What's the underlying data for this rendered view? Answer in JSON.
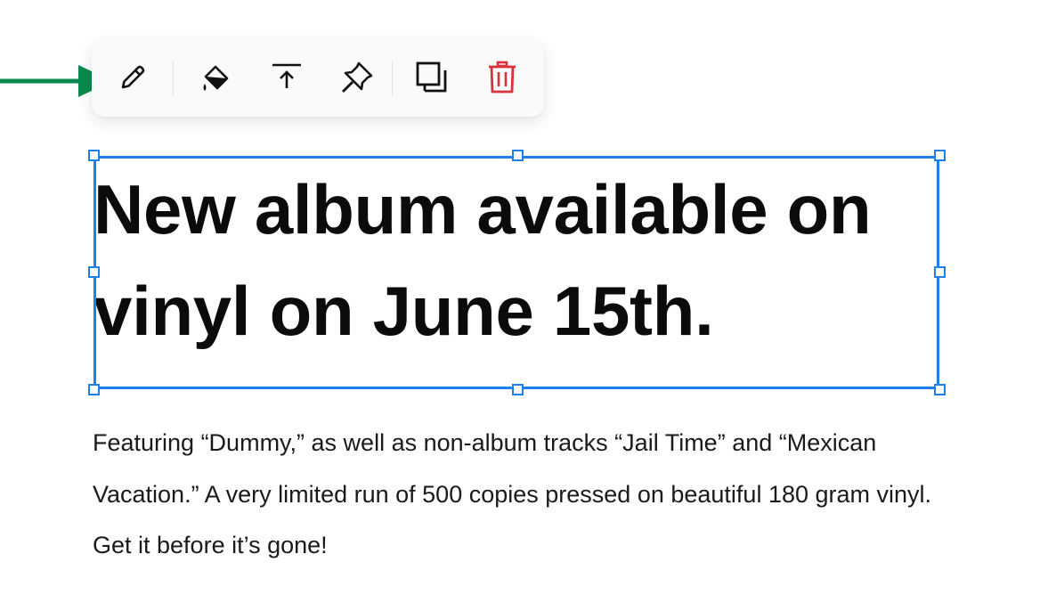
{
  "toolbar": {
    "buttons": [
      {
        "name": "edit",
        "icon": "pencil-icon"
      },
      {
        "name": "fill-color",
        "icon": "paint-bucket-icon"
      },
      {
        "name": "move-to-top",
        "icon": "arrow-up-to-line-icon"
      },
      {
        "name": "pin",
        "icon": "pushpin-icon"
      },
      {
        "name": "duplicate",
        "icon": "copy-icon"
      },
      {
        "name": "delete",
        "icon": "trash-icon"
      }
    ]
  },
  "annotation": {
    "arrow_color": "#0a8a4f",
    "target": "pencil-icon"
  },
  "colors": {
    "selection": "#1f80ea",
    "delete": "#d8323c",
    "icon": "#111111"
  },
  "content": {
    "headline": "New album available on vinyl on June 15th.",
    "description": "Featuring “Dummy,” as well as non-album tracks “Jail Time” and “Mexican Vacation.” A very limited run of 500 copies pressed on beautiful 180 gram vinyl. Get it before it’s gone!"
  }
}
